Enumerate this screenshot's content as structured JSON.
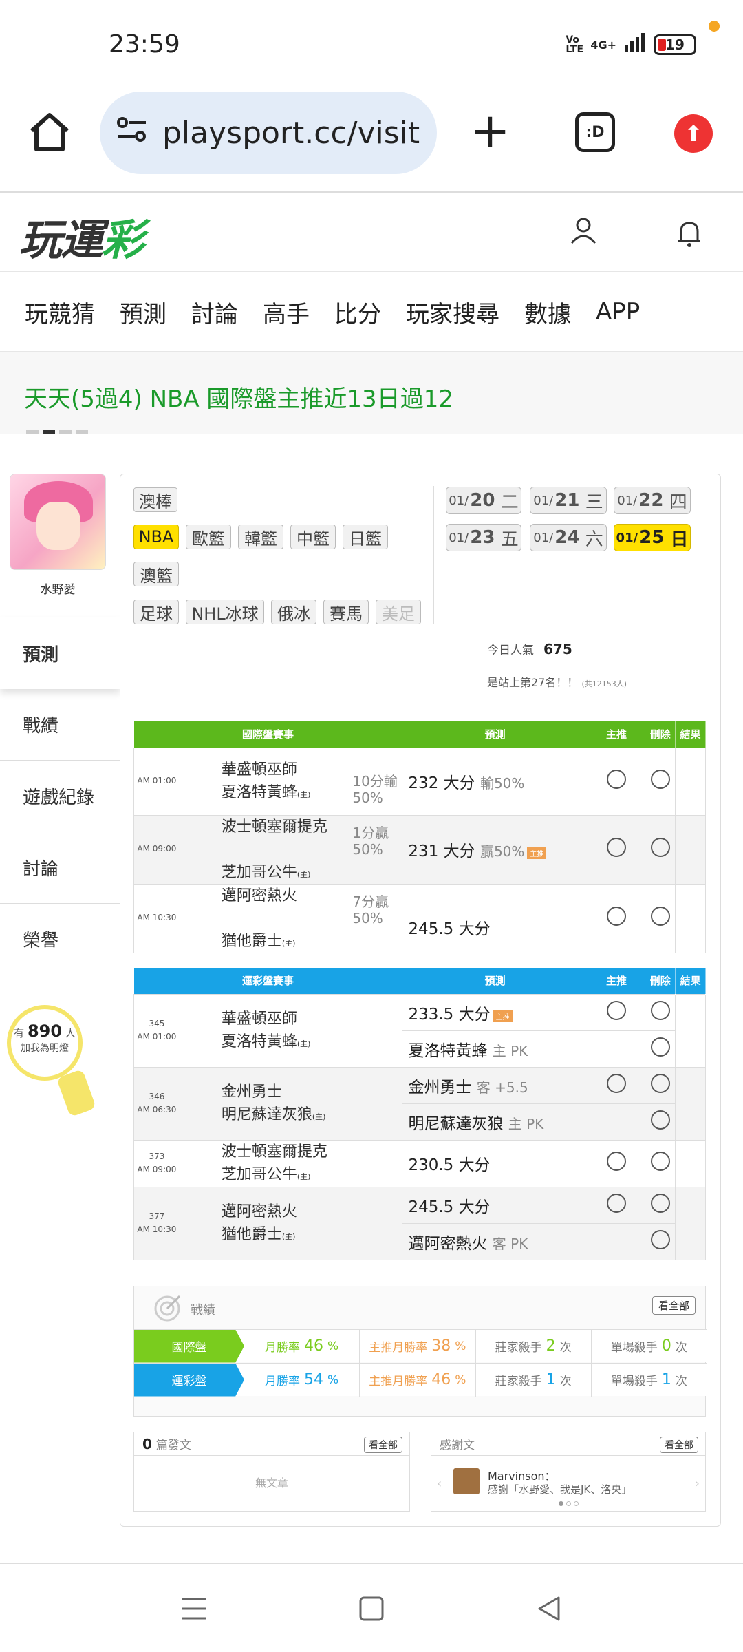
{
  "status": {
    "time": "23:59",
    "network": "4G+",
    "volte": "Vo LTE",
    "battery": "19"
  },
  "browser": {
    "url": "playsport.cc/visit"
  },
  "site": {
    "logo_a": "玩運",
    "logo_b": "彩"
  },
  "nav": [
    "玩競猜",
    "預測",
    "討論",
    "高手",
    "比分",
    "玩家搜尋",
    "數據",
    "APP"
  ],
  "banner": {
    "text": "天天(5過4) NBA 國際盤主推近13日過12"
  },
  "profile": {
    "name": "水野愛"
  },
  "side_menu": [
    "預測",
    "戰績",
    "遊戲紀錄",
    "討論",
    "榮譽"
  ],
  "fans": {
    "prefix": "有",
    "count": "890",
    "suffix": "人",
    "caption": "加我為明燈"
  },
  "sports": {
    "row1": [
      "澳棒"
    ],
    "row2": [
      "NBA",
      "歐籃",
      "韓籃",
      "中籃",
      "日籃"
    ],
    "row3": [
      "澳籃"
    ],
    "row4": [
      "足球",
      "NHL冰球",
      "俄冰",
      "賽馬",
      "美足"
    ]
  },
  "dates": [
    {
      "md": "01/",
      "d": "20",
      "w": "二"
    },
    {
      "md": "01/",
      "d": "21",
      "w": "三"
    },
    {
      "md": "01/",
      "d": "22",
      "w": "四"
    },
    {
      "md": "01/",
      "d": "23",
      "w": "五"
    },
    {
      "md": "01/",
      "d": "24",
      "w": "六"
    },
    {
      "md": "01/",
      "d": "25",
      "w": "日"
    }
  ],
  "popularity": {
    "label": "今日人氣",
    "value": "675",
    "rank": "是站上第27名！！",
    "total": "(共12153人)"
  },
  "intl": {
    "headers": [
      "國際盤賽事",
      "預測",
      "主推",
      "刪除",
      "結果"
    ],
    "rows": [
      {
        "time": "AM 01:00",
        "home": "華盛頓巫師",
        "away": "夏洛特黃蜂",
        "mark": "(主)",
        "odds_a": "10分輸",
        "odds_b": "50%",
        "pred": "232 大分",
        "pred2": "輸50%",
        "tag": ""
      },
      {
        "time": "AM 09:00",
        "home": "波士頓塞爾提克",
        "away": "芝加哥公牛",
        "mark": "(主)",
        "odds_a": "1分贏",
        "odds_b": "50%",
        "pred": "231 大分",
        "pred2": "贏50%",
        "tag": "主推"
      },
      {
        "time": "AM 10:30",
        "home": "邁阿密熱火",
        "away": "猶他爵士",
        "mark": "(主)",
        "odds_a": "7分贏",
        "odds_b": "50%",
        "pred": "245.5 大分",
        "pred2": "",
        "tag": ""
      }
    ]
  },
  "lottery": {
    "headers": [
      "運彩盤賽事",
      "預測",
      "主推",
      "刪除",
      "結果"
    ],
    "groups": [
      {
        "no": "345",
        "time": "AM 01:00",
        "home": "華盛頓巫師",
        "away": "夏洛特黃蜂",
        "mark": "(主)",
        "preds": [
          {
            "main": "233.5 大分",
            "sub": "",
            "tag": "主推"
          },
          {
            "main": "夏洛特黃蜂",
            "sub": "主 PK",
            "tag": ""
          }
        ]
      },
      {
        "no": "346",
        "time": "AM 06:30",
        "home": "金州勇士",
        "away": "明尼蘇達灰狼",
        "mark": "(主)",
        "preds": [
          {
            "main": "金州勇士",
            "sub": "客 +5.5",
            "tag": ""
          },
          {
            "main": "明尼蘇達灰狼",
            "sub": "主 PK",
            "tag": ""
          }
        ]
      },
      {
        "no": "373",
        "time": "AM 09:00",
        "home": "波士頓塞爾提克",
        "away": "芝加哥公牛",
        "mark": "(主)",
        "preds": [
          {
            "main": "230.5 大分",
            "sub": "",
            "tag": ""
          }
        ]
      },
      {
        "no": "377",
        "time": "AM 10:30",
        "home": "邁阿密熱火",
        "away": "猶他爵士",
        "mark": "(主)",
        "preds": [
          {
            "main": "245.5 大分",
            "sub": "",
            "tag": ""
          },
          {
            "main": "邁阿密熱火",
            "sub": "客 PK",
            "tag": ""
          }
        ]
      }
    ]
  },
  "record": {
    "title": "戰績",
    "all": "看全部",
    "rows": [
      {
        "label": "國際盤",
        "color": "#7acc1e",
        "m": "46",
        "mm": "38",
        "k": "2",
        "s": "0"
      },
      {
        "label": "運彩盤",
        "color": "#18a3e6",
        "m": "54",
        "mm": "46",
        "k": "1",
        "s": "1"
      }
    ],
    "labels": {
      "monthly": "月勝率",
      "main_monthly": "主推月勝率",
      "killer": "莊家殺手",
      "single": "單場殺手",
      "pct": "%",
      "times": "次"
    }
  },
  "posts": {
    "count": "0",
    "label": "篇發文",
    "all": "看全部",
    "empty": "無文章"
  },
  "thanks": {
    "label": "感謝文",
    "all": "看全部",
    "user": "Marvinson：",
    "text": "感謝「水野愛、我是JK、洛央」"
  }
}
